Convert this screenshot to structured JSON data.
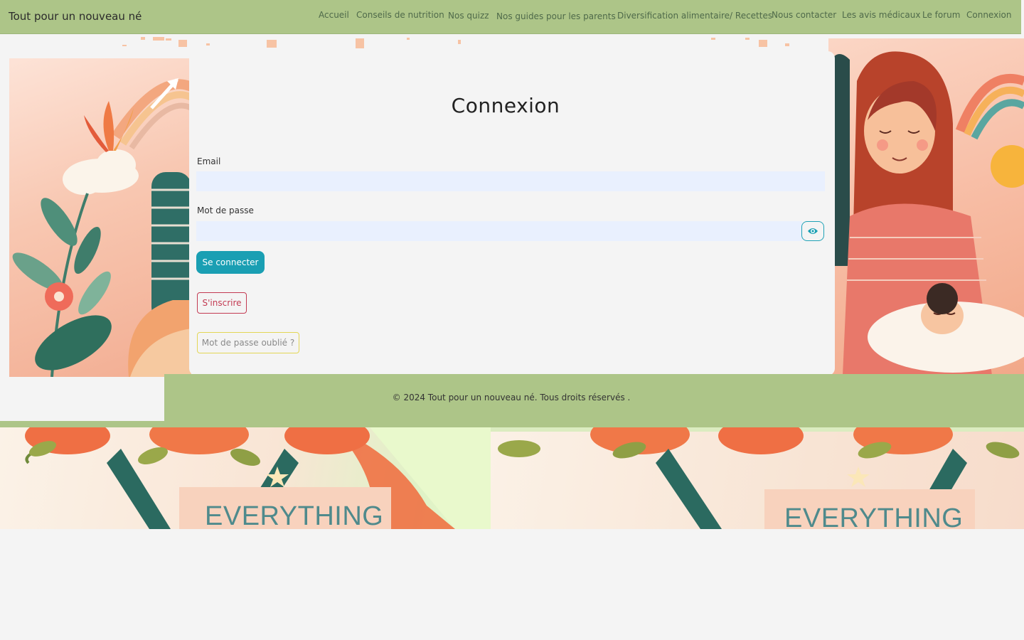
{
  "nav": {
    "brand": "Tout pour un nouveau né",
    "links": [
      {
        "label": "Accueil"
      },
      {
        "label": "Conseils de nutrition"
      },
      {
        "label": "Nos quizz"
      },
      {
        "label": "Nos guides pour les parents"
      },
      {
        "label": "Diversification alimentaire/ Recettes"
      },
      {
        "label": "Nous contacter"
      },
      {
        "label": "Les avis médicaux"
      },
      {
        "label": "Le forum"
      },
      {
        "label": "Connexion"
      }
    ]
  },
  "login": {
    "title": "Connexion",
    "email_label": "Email",
    "email_value": "",
    "password_label": "Mot de passe",
    "password_value": "",
    "submit_label": "Se connecter",
    "register_label": "S'inscrire",
    "forgot_label": "Mot de passe oublié ?"
  },
  "footer": {
    "text": "© 2024 Tout pour un nouveau né. Tous droits réservés ."
  },
  "banners": [
    {
      "label": "EVERYTHING"
    },
    {
      "label": "EVERYTHING"
    }
  ],
  "colors": {
    "nav_bg": "#adc588",
    "primary_button": "#1a9fb3",
    "register_border": "#c33a52",
    "forgot_border": "#e3d655",
    "input_bg": "#e9f0fe"
  },
  "icons": {
    "password_toggle": "eye-icon"
  }
}
